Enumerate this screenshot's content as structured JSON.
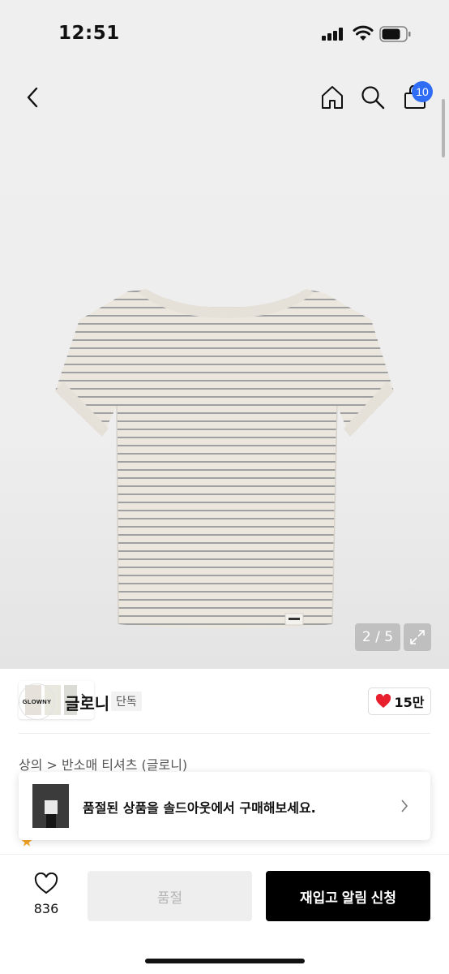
{
  "status_bar": {
    "time": "12:51"
  },
  "header": {
    "cart_count": "10"
  },
  "gallery": {
    "pager": "2 / 5"
  },
  "brand": {
    "logo_text": "GLOWNY",
    "name": "글로니",
    "tag": "단독",
    "likes": "15만"
  },
  "breadcrumb": "상의 > 반소매 티셔츠 (글로니)",
  "toast": {
    "message": "품절된 상품을 솔드아웃에서 구매해보세요."
  },
  "bottom_bar": {
    "wish_count": "836",
    "soldout_label": "품절",
    "restock_label": "재입고 알림 신청"
  },
  "colors": {
    "accent_badge": "#2f6df6",
    "like_heart": "#e8202e",
    "primary_button": "#000000"
  },
  "icons": [
    "back-icon",
    "home-icon",
    "search-icon",
    "cart-icon",
    "chevron-right-icon",
    "expand-icon",
    "heart-icon",
    "star-icon"
  ]
}
